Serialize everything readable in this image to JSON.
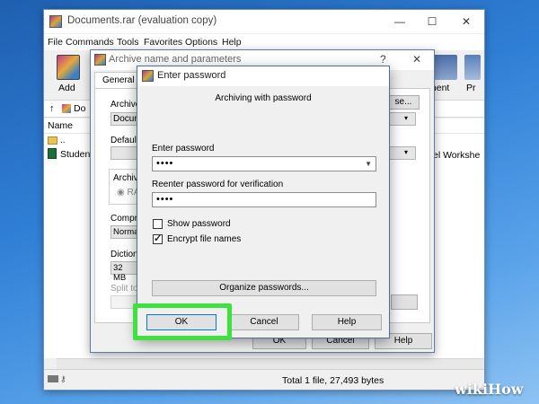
{
  "main_window": {
    "title": "Documents.rar (evaluation copy)",
    "menu": [
      "File",
      "Commands",
      "Tools",
      "Favorites",
      "Options",
      "Help"
    ],
    "toolbar": {
      "add_label": "Add",
      "partial_right_1": "ment",
      "partial_right_2": "Pr"
    },
    "address_partial": "Do",
    "list_header_name": "Name",
    "list_header_type_partial": "el Workshe",
    "list_items": [
      {
        "name": ".."
      },
      {
        "name": "Student"
      }
    ],
    "status_text": "Total 1 file, 27,493 bytes",
    "window_buttons": {
      "minimize": "—",
      "maximize": "☐",
      "close": "✕"
    }
  },
  "archive_dialog": {
    "title": "Archive name and parameters",
    "help_glyph": "?",
    "close_glyph": "✕",
    "tab_general": "General",
    "label_archive_partial": "Archive",
    "archive_name_partial": "Docum",
    "browse_partial": "se...",
    "label_default_partial": "Default",
    "group_archive_partial": "Archive",
    "radio_rar_partial": "RA",
    "label_compression_partial": "Compre",
    "compression_value_partial": "Normal",
    "label_dictionary_partial": "Dictiona",
    "dictionary_value_partial": "32 MB",
    "label_split_partial": "Split to",
    "buttons": {
      "ok": "OK",
      "cancel": "Cancel",
      "help": "Help"
    }
  },
  "password_dialog": {
    "title": "Enter password",
    "heading": "Archiving with password",
    "label_enter": "Enter password",
    "enter_value": "••••",
    "label_reenter": "Reenter password for verification",
    "reenter_value": "••••",
    "show_password_label": "Show password",
    "show_password_checked": false,
    "encrypt_names_label": "Encrypt file names",
    "encrypt_names_checked": true,
    "organize_label": "Organize passwords...",
    "buttons": {
      "ok": "OK",
      "cancel": "Cancel",
      "help": "Help"
    }
  },
  "highlight_color": "#3ee23e",
  "watermark": "wikiHow"
}
